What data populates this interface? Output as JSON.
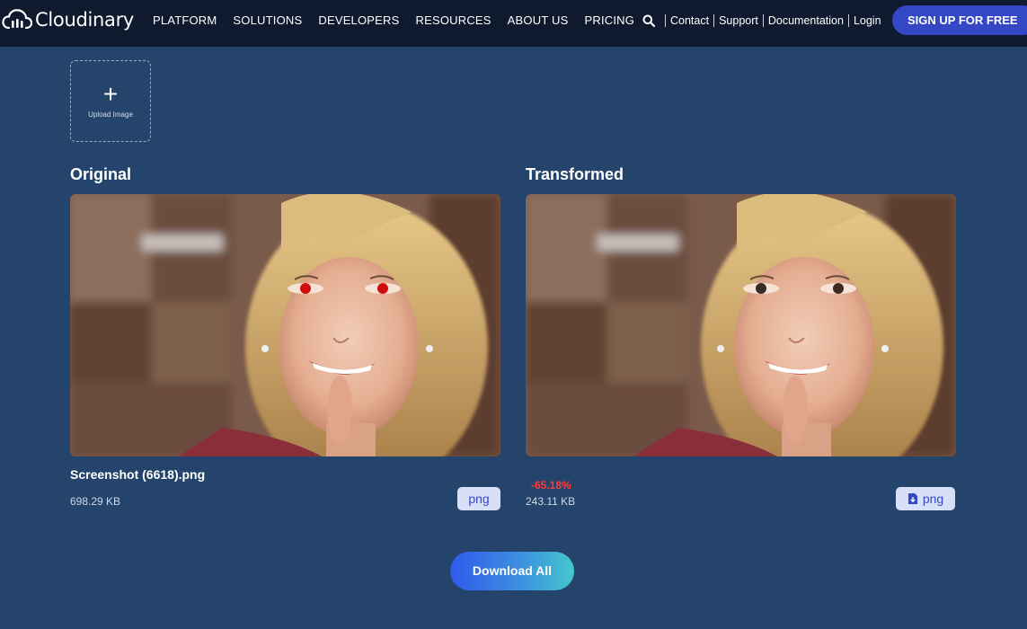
{
  "brand": {
    "name": "Cloudinary"
  },
  "nav": {
    "menu": [
      "PLATFORM",
      "SOLUTIONS",
      "DEVELOPERS",
      "RESOURCES",
      "ABOUT US",
      "PRICING"
    ],
    "links": [
      "Contact",
      "Support",
      "Documentation",
      "Login"
    ],
    "signup_label": "SIGN UP FOR FREE",
    "search_icon": "search-icon"
  },
  "upload": {
    "label": "Upload Image",
    "icon": "plus-icon"
  },
  "original": {
    "heading": "Original",
    "filename": "Screenshot (6618).png",
    "size": "698.29 KB",
    "format": "png"
  },
  "transformed": {
    "heading": "Transformed",
    "reduction": "-65.18%",
    "size": "243.11 KB",
    "format": "png",
    "format_icon": "file-download-icon"
  },
  "actions": {
    "download_all": "Download All"
  },
  "colors": {
    "background": "#24446b",
    "navbar": "#0f1a2e",
    "accent": "#3448c5",
    "reduction": "#ff3b3b",
    "badge": "#d7e0f6"
  }
}
